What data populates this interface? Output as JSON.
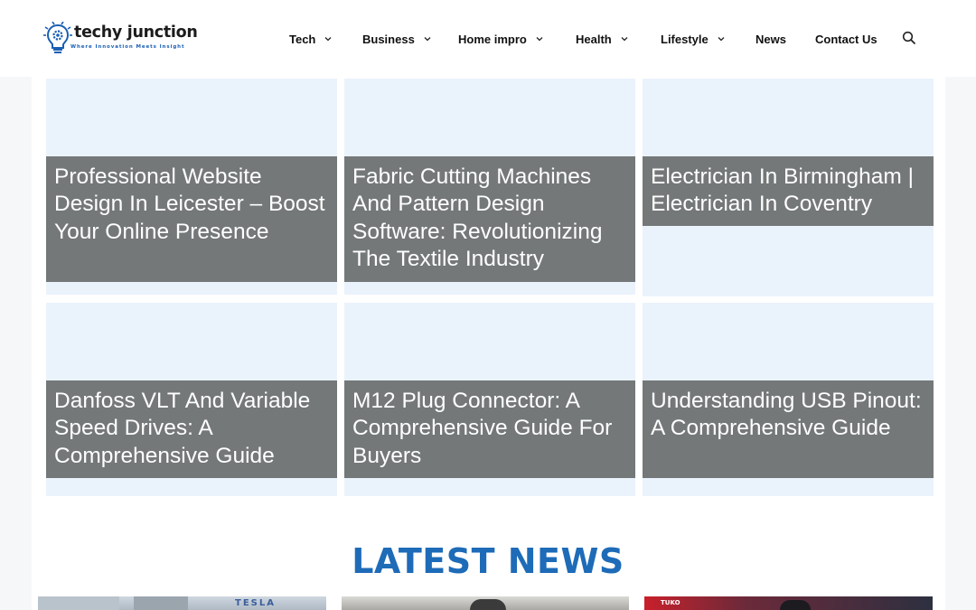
{
  "brand": {
    "name": "techy junction",
    "tagline": "Where Innovation Meets Insight"
  },
  "nav": {
    "items": [
      {
        "label": "Tech",
        "dropdown": true
      },
      {
        "label": "Business",
        "dropdown": true
      },
      {
        "label": "Home impro",
        "dropdown": true
      },
      {
        "label": "Health",
        "dropdown": true
      },
      {
        "label": "Lifestyle",
        "dropdown": true
      },
      {
        "label": "News",
        "dropdown": false
      },
      {
        "label": "Contact Us",
        "dropdown": false
      }
    ],
    "search_icon": "search-icon"
  },
  "cards": [
    {
      "title": "Professional Website Design In Leicester – Boost Your Online Presence"
    },
    {
      "title": "Fabric Cutting Machines And Pattern Design Software: Revolutionizing The Textile Industry"
    },
    {
      "title": "Electrician In Birmingham | Electrician In Coventry"
    },
    {
      "title": "Danfoss VLT And Variable Speed Drives: A Comprehensive Guide"
    },
    {
      "title": "M12 Plug Connector: A Comprehensive Guide For Buyers"
    },
    {
      "title": "Understanding USB Pinout: A Comprehensive Guide"
    }
  ],
  "latest_news": {
    "heading": "LATEST NEWS",
    "thumbnails": [
      {
        "overlay_text": "TESLA"
      },
      {
        "overlay_text": ""
      },
      {
        "overlay_text": "TUKO"
      }
    ]
  },
  "colors": {
    "accent_blue": "#1e6bb8",
    "caption_bg": "#747879",
    "card_bg": "#eaf3fc"
  }
}
